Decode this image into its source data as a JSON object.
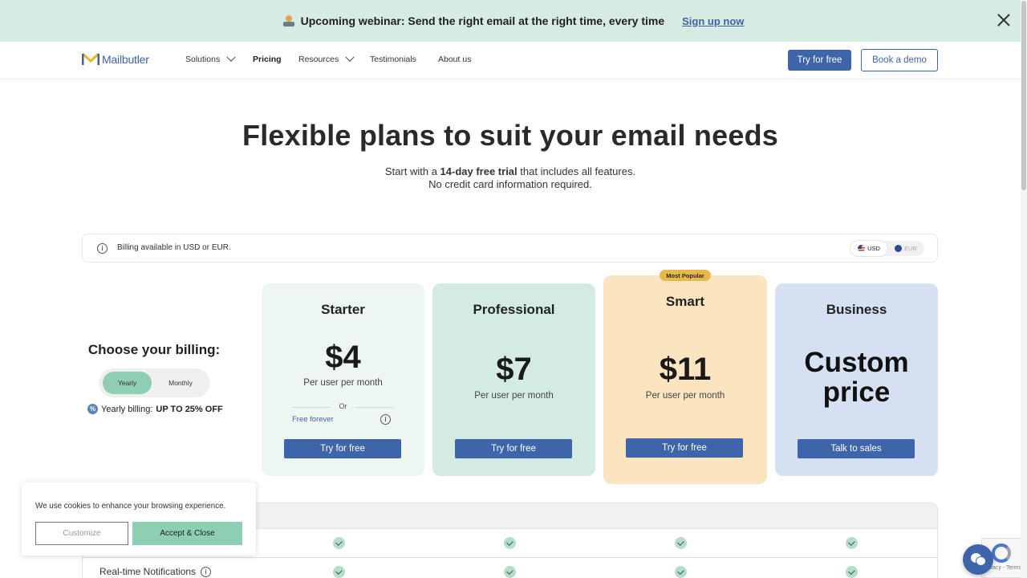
{
  "banner": {
    "text": "Upcoming webinar: Send the right email at the right time, every time",
    "link": "Sign up now"
  },
  "nav": {
    "logo": "Mailbutler",
    "items": [
      {
        "label": "Solutions"
      },
      {
        "label": "Pricing"
      },
      {
        "label": "Resources"
      },
      {
        "label": "Testimonials"
      },
      {
        "label": "About us"
      }
    ],
    "try_label": "Try for free",
    "demo_label": "Book a demo"
  },
  "hero": {
    "title": "Flexible plans to suit your email needs",
    "sub_pre": "Start with a ",
    "sub_bold": "14-day free trial",
    "sub_post": " that includes all features.",
    "sub_line2": "No credit card information required."
  },
  "billing_info": {
    "text": "Billing available in USD or EUR.",
    "currencies": [
      "USD",
      "EUR"
    ],
    "selected_currency": "USD"
  },
  "billing_choice": {
    "title": "Choose your billing:",
    "yearly": "Yearly",
    "monthly": "Monthly",
    "selected": "Yearly",
    "discount_pre": "Yearly billing:",
    "discount_bold": "UP TO 25% OFF"
  },
  "plans": [
    {
      "name": "Starter",
      "price": "$4",
      "per": "Per user per month",
      "or": "Or",
      "free": "Free forever",
      "cta": "Try for free"
    },
    {
      "name": "Professional",
      "price": "$7",
      "per": "Per user per month",
      "cta": "Try for free"
    },
    {
      "name": "Smart",
      "price": "$11",
      "per": "Per user per month",
      "cta": "Try for free",
      "badge": "Most Popular"
    },
    {
      "name": "Business",
      "price_line1": "Custom",
      "price_line2": "price",
      "cta": "Talk to sales"
    }
  ],
  "features": [
    {
      "label": ""
    },
    {
      "label": "Real-time Notifications"
    }
  ],
  "cookie": {
    "text": "We use cookies to enhance your browsing experience.",
    "customize": "Customize",
    "accept": "Accept & Close"
  },
  "recaptcha": {
    "text": "Privacy - Terms"
  },
  "colors": {
    "brand_blue": "#3e65a9",
    "banner_bg": "#d6ece3",
    "mint": "#8ecfb3",
    "starter_bg": "#eef6f2",
    "pro_bg": "#d3ebe2",
    "smart_bg": "#fbe4c0",
    "business_bg": "#d6e0f3",
    "badge_gold": "#e8b84a"
  }
}
